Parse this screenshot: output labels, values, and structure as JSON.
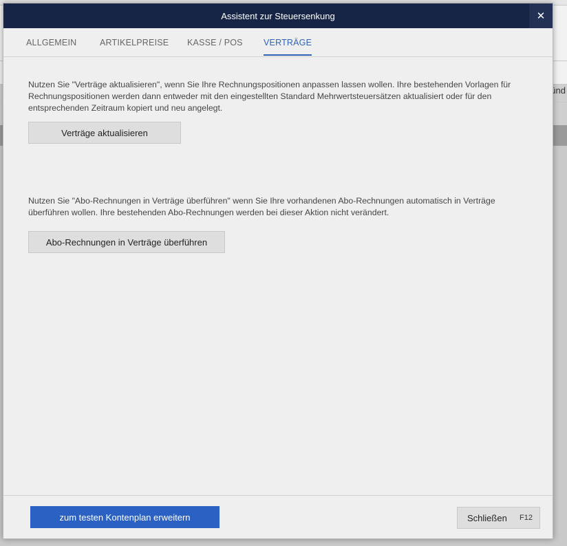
{
  "background": {
    "right_fragment": "ünd"
  },
  "dialog": {
    "title": "Assistent zur Steuersenkung",
    "close_symbol": "✕"
  },
  "tabs": [
    {
      "label": "ALLGEMEIN",
      "active": false
    },
    {
      "label": "ARTIKELPREISE",
      "active": false
    },
    {
      "label": "KASSE / POS",
      "active": false
    },
    {
      "label": "VERTRÄGE",
      "active": true
    }
  ],
  "content": {
    "paragraph1": "Nutzen Sie \"Verträge aktualisieren\", wenn Sie Ihre Rechnungspositionen anpassen lassen wollen. Ihre bestehenden Vorlagen für Rechnungspositionen werden dann entweder mit den eingestellten Standard Mehrwertsteuersätzen aktualisiert oder für den entsprechenden Zeitraum kopiert und neu angelegt.",
    "button1": "Verträge aktualisieren",
    "paragraph2": "Nutzen Sie \"Abo-Rechnungen in Verträge überführen\" wenn Sie Ihre vorhandenen Abo-Rechnungen automatisch in Verträge überführen wollen. Ihre bestehenden Abo-Rechnungen werden bei dieser Aktion nicht verändert.",
    "button2": "Abo-Rechnungen in Verträge überführen"
  },
  "footer": {
    "primary_button": "zum testen Kontenplan erweitern",
    "close_button": "Schließen",
    "close_shortcut": "F12"
  },
  "colors": {
    "titlebar": "#162445",
    "accent": "#2f62b5",
    "primary_button": "#2a61c3"
  }
}
